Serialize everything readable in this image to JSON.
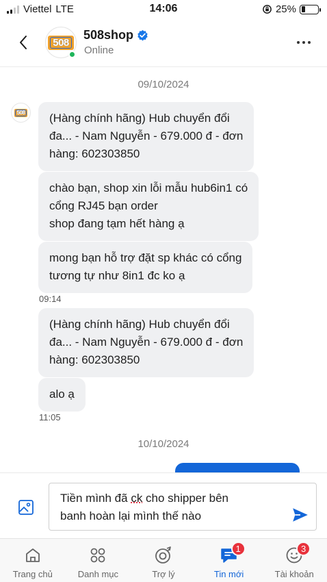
{
  "status_bar": {
    "carrier": "Viettel",
    "network": "LTE",
    "time": "14:06",
    "battery": "25%",
    "battery_level": 0.25
  },
  "header": {
    "back_icon": "chevron-left-icon",
    "logo_text": "508",
    "shop_name": "508shop",
    "verified_icon": "verified-badge-icon",
    "status": "Online",
    "more_icon": "more-horizontal-icon"
  },
  "chat": {
    "date_1": "09/10/2024",
    "messages": [
      {
        "text": "(Hàng chính hãng) Hub chuyển đổi\nđa... - Nam Nguyễn - 679.000 đ - đơn\nhàng: 602303850"
      },
      {
        "text": "chào bạn, shop xin lỗi mẫu hub6in1 có\ncổng RJ45 bạn order\nshop đang tạm hết hàng ạ"
      },
      {
        "text": "mong bạn hỗ trợ đặt sp khác có cổng\ntương tự như 8in1 đc ko ạ"
      },
      {
        "text": "(Hàng chính hãng) Hub chuyển đổi\nđa... - Nam Nguyễn - 679.000 đ - đơn\nhàng: 602303850"
      },
      {
        "text": "alo ạ"
      }
    ],
    "time_1": "09:14",
    "time_2": "11:05",
    "date_2": "10/10/2024"
  },
  "composer": {
    "text_before": "Tiền mình đã ",
    "text_ck": "ck",
    "text_after": " cho shipper bên\nbanh hoàn lại mình thế nào",
    "image_icon": "image-icon",
    "send_icon": "send-icon"
  },
  "bottom_nav": {
    "items": [
      {
        "label": "Trang chủ",
        "icon": "shop-icon"
      },
      {
        "label": "Danh mục",
        "icon": "grid-icon"
      },
      {
        "label": "Trợ lý",
        "icon": "assistant-icon"
      },
      {
        "label": "Tin mới",
        "icon": "chat-icon",
        "badge": "1"
      },
      {
        "label": "Tài khoản",
        "icon": "smiley-icon",
        "badge": "3"
      }
    ],
    "active_color": "#1366d8"
  },
  "colors": {
    "accent": "#1366d8",
    "bubble_in": "#eff0f2",
    "online": "#1fb55b",
    "badge": "#e8323c",
    "logo_orange": "#f1a22c"
  }
}
